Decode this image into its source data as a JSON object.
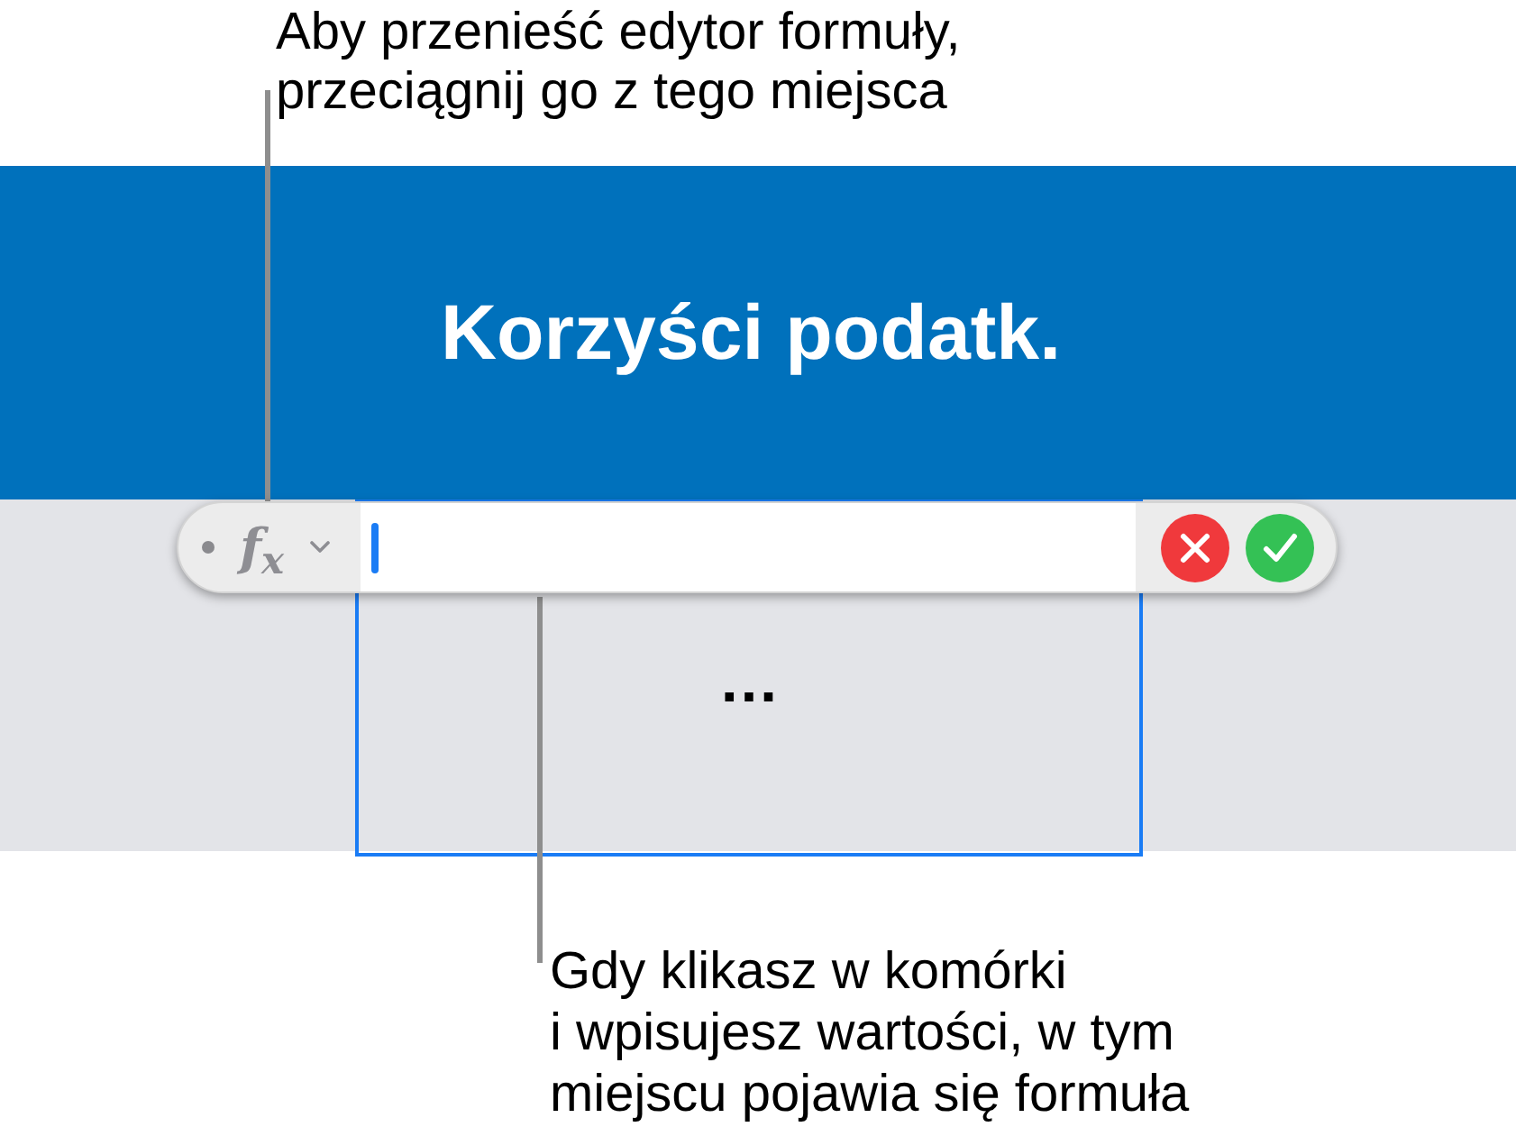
{
  "top_callout": {
    "lines": [
      "Aby przenieść edytor formuły,",
      "przeciągnij go z tego miejsca"
    ]
  },
  "header": {
    "title": "Korzyści podatk."
  },
  "formula_bar": {
    "function_label": "f$_{x}$",
    "focused": true
  },
  "cell": {
    "value": "…",
    "selected": true
  },
  "bottom_callout": {
    "lines": [
      "Gdy klikasz w komórki",
      "i wpisujesz wartości, w tym",
      "miejscu pojawia się formuła"
    ]
  }
}
